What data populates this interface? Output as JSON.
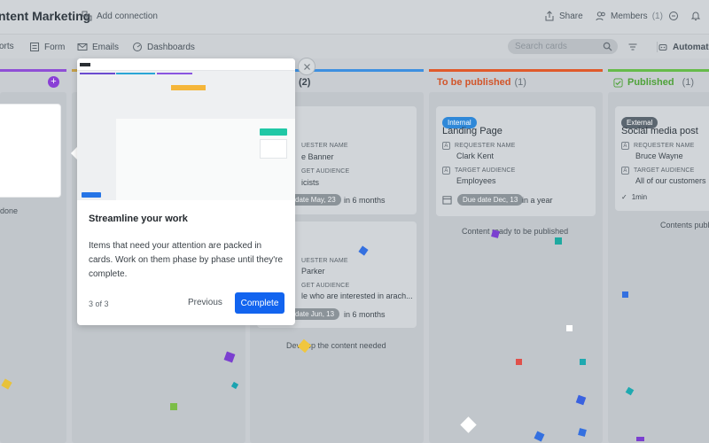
{
  "header": {
    "title": "ntent Marketing",
    "add_connection": "Add connection",
    "share": "Share",
    "members_label": "Members",
    "members_count": "(1)"
  },
  "tabs": [
    {
      "label": "orts"
    },
    {
      "label": "Form"
    },
    {
      "label": "Emails"
    },
    {
      "label": "Dashboards"
    }
  ],
  "search": {
    "placeholder": "Search cards"
  },
  "automate": "Automate",
  "phases": [
    {
      "name": "To be published",
      "count": "(1)",
      "color": "#e05a2b"
    },
    {
      "name": "Published",
      "count": "(1)",
      "color": "#66bb4a"
    },
    {
      "count": "(2)",
      "color": "#3d8fe0"
    }
  ],
  "cards": {
    "landing": {
      "badge": "Internal",
      "badge_color": "#2f88d8",
      "title": "Landing Page",
      "requester_label": "REQUESTER NAME",
      "requester": "Clark Kent",
      "audience_label": "TARGET AUDIENCE",
      "audience": "Employees",
      "due": "Due date Dec, 13",
      "relative": "in a year"
    },
    "social": {
      "badge": "External",
      "badge_color": "#5b6670",
      "title": "Social media post",
      "requester_label": "REQUESTER NAME",
      "requester": "Bruce Wayne",
      "audience_label": "TARGET AUDIENCE",
      "audience": "All of our customers",
      "time": "1min"
    },
    "col2_a": {
      "requester_label": "UESTER NAME",
      "requester": "e Banner",
      "audience_label": "GET AUDIENCE",
      "audience": "icists",
      "due": "date May, 23",
      "relative": "in 6 months"
    },
    "col2_b": {
      "requester_label": "UESTER NAME",
      "requester": "Parker",
      "audience_label": "GET AUDIENCE",
      "audience": "le who are interested in arach...",
      "due": "date Jun, 13",
      "relative": "in 6 months"
    }
  },
  "footers": {
    "col1": "done",
    "col2": "Develop the content needed",
    "col3": "Content ready to be published",
    "col4": "Contents publ"
  },
  "tour": {
    "title": "Streamline your work",
    "body": "Items that need your attention are packed in cards. Work on them phase by phase until they're complete.",
    "step": "3 of 3",
    "previous": "Previous",
    "complete": "Complete"
  }
}
